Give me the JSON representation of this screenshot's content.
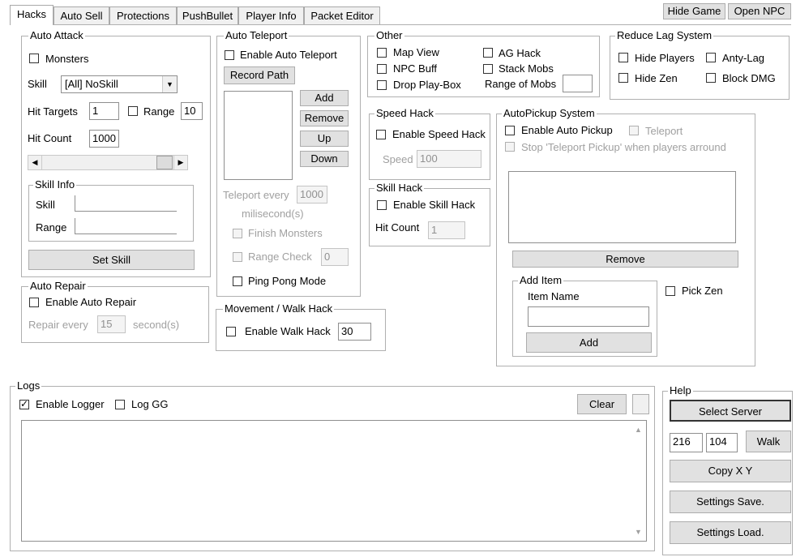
{
  "tabs": [
    "Hacks",
    "Auto Sell",
    "Protections",
    "PushBullet",
    "Player Info",
    "Packet Editor"
  ],
  "top_buttons": {
    "hide_game": "Hide Game",
    "open_npc": "Open NPC"
  },
  "auto_attack": {
    "title": "Auto Attack",
    "monsters": "Monsters",
    "skill_label": "Skill",
    "skill_value": "[All] NoSkill",
    "hit_targets_label": "Hit Targets",
    "hit_targets_value": "1",
    "range_label": "Range",
    "range_value": "10",
    "hit_count_label": "Hit Count",
    "hit_count_value": "1000",
    "skill_info": {
      "title": "Skill Info",
      "skill": "Skill",
      "range": "Range"
    },
    "set_skill": "Set Skill"
  },
  "auto_repair": {
    "title": "Auto Repair",
    "enable": "Enable Auto Repair",
    "repair_every": "Repair every",
    "repair_value": "15",
    "seconds": "second(s)"
  },
  "auto_teleport": {
    "title": "Auto Teleport",
    "enable": "Enable Auto Teleport",
    "record_path": "Record Path",
    "add": "Add",
    "remove": "Remove",
    "up": "Up",
    "down": "Down",
    "teleport_every": "Teleport every",
    "teleport_value": "1000",
    "miliseconds": "milisecond(s)",
    "finish_monsters": "Finish Monsters",
    "range_check": "Range Check",
    "range_check_value": "0",
    "ping_pong": "Ping Pong Mode"
  },
  "movement": {
    "title": "Movement / Walk Hack",
    "enable": "Enable Walk Hack",
    "value": "30"
  },
  "other": {
    "title": "Other",
    "map_view": "Map View",
    "npc_buff": "NPC Buff",
    "drop_play_box": "Drop Play-Box",
    "ag_hack": "AG Hack",
    "stack_mobs": "Stack Mobs",
    "range_of_mobs": "Range of Mobs"
  },
  "speed_hack": {
    "title": "Speed Hack",
    "enable": "Enable Speed Hack",
    "speed_label": "Speed",
    "speed_value": "100"
  },
  "skill_hack": {
    "title": "Skill Hack",
    "enable": "Enable Skill Hack",
    "hit_count_label": "Hit Count",
    "hit_count_value": "1"
  },
  "reduce_lag": {
    "title": "Reduce Lag System",
    "hide_players": "Hide Players",
    "anty_lag": "Anty-Lag",
    "hide_zen": "Hide Zen",
    "block_dmg": "Block DMG"
  },
  "autopickup": {
    "title": "AutoPickup System",
    "enable": "Enable Auto Pickup",
    "teleport": "Teleport",
    "stop_teleport": "Stop 'Teleport Pickup' when players arround",
    "remove": "Remove",
    "add_item": {
      "title": "Add Item",
      "item_name": "Item Name",
      "add": "Add"
    },
    "pick_zen": "Pick Zen"
  },
  "logs": {
    "title": "Logs",
    "enable_logger": "Enable Logger",
    "log_gg": "Log GG",
    "clear": "Clear"
  },
  "help": {
    "title": "Help",
    "select_server": "Select Server",
    "x": "216",
    "y": "104",
    "walk": "Walk",
    "copy_xy": "Copy X Y",
    "settings_save": "Settings Save.",
    "settings_load": "Settings Load."
  }
}
